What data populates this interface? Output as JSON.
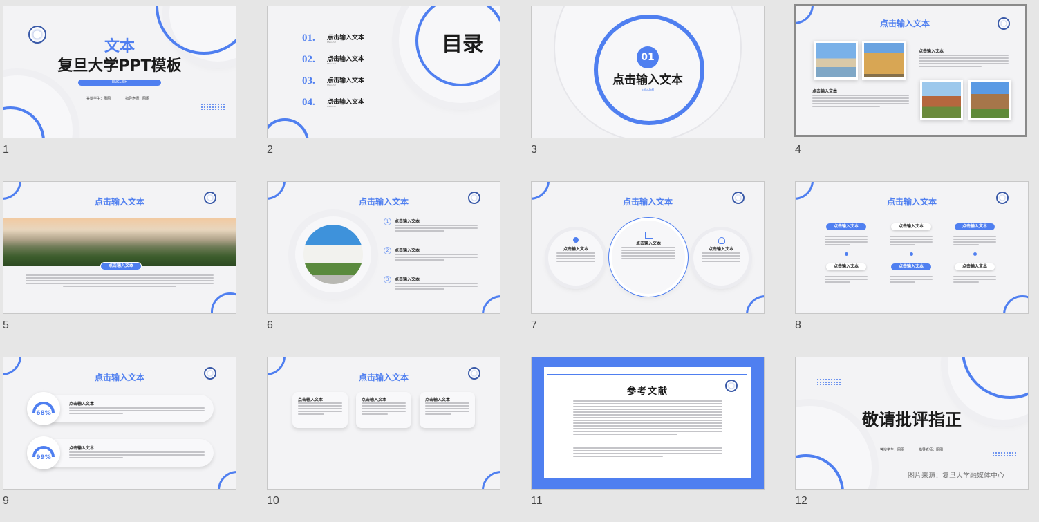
{
  "slides": [
    {
      "number": "1",
      "title_top": "文本",
      "title_main": "复旦大学PPT模板",
      "subtitle": "ENGLISH",
      "presenter": "答辩学生：图图",
      "advisor": "指导老师：图图"
    },
    {
      "number": "2",
      "heading": "目录",
      "items": [
        {
          "num": "01.",
          "label": "点击输入文本",
          "sub": "ENGLISH"
        },
        {
          "num": "02.",
          "label": "点击输入文本",
          "sub": "ENGLISH"
        },
        {
          "num": "03.",
          "label": "点击输入文本",
          "sub": "ENGLISH"
        },
        {
          "num": "04.",
          "label": "点击输入文本",
          "sub": "ENGLISH"
        }
      ]
    },
    {
      "number": "3",
      "badge": "01",
      "title": "点击输入文本",
      "sub": "ENGLISH"
    },
    {
      "number": "4",
      "header": "点击输入文本",
      "block1_title": "点击输入文本",
      "block2_title": "点击输入文本"
    },
    {
      "number": "5",
      "header": "点击输入文本",
      "pill": "点击输入文本"
    },
    {
      "number": "6",
      "header": "点击输入文本",
      "items": [
        {
          "n": "1",
          "t": "点击输入文本"
        },
        {
          "n": "2",
          "t": "点击输入文本"
        },
        {
          "n": "3",
          "t": "点击输入文本"
        }
      ]
    },
    {
      "number": "7",
      "header": "点击输入文本",
      "circles": [
        "点击输入文本",
        "点击输入文本",
        "点击输入文本"
      ]
    },
    {
      "number": "8",
      "header": "点击输入文本",
      "top": [
        "点击输入文本",
        "点击输入文本",
        "点击输入文本"
      ],
      "bottom": [
        "点击输入文本",
        "点击输入文本",
        "点击输入文本"
      ]
    },
    {
      "number": "9",
      "header": "点击输入文本",
      "rows": [
        {
          "pct": "68%",
          "t": "点击输入文本"
        },
        {
          "pct": "99%",
          "t": "点击输入文本"
        }
      ]
    },
    {
      "number": "10",
      "header": "点击输入文本",
      "cards": [
        "点击输入文本",
        "点击输入文本",
        "点击输入文本"
      ]
    },
    {
      "number": "11",
      "heading": "参考文献"
    },
    {
      "number": "12",
      "heading": "敬请批评指正",
      "presenter": "答辩学生：图图",
      "advisor": "指导老师：图图",
      "credit": "图片来源：复旦大学融媒体中心"
    }
  ],
  "colors": {
    "accent": "#4f7ff0",
    "background": "#e6e6e6",
    "slide": "#f3f3f5"
  },
  "selected_slide": "4"
}
